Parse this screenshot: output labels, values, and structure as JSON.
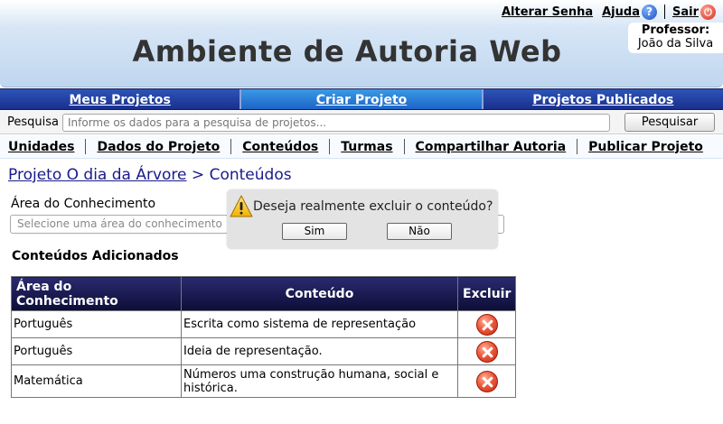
{
  "header": {
    "app_title": "Ambiente de Autoria Web",
    "links": {
      "change_password": "Alterar Senha",
      "help": "Ajuda",
      "logout": "Sair"
    },
    "user": {
      "role": "Professor:",
      "name": "João da Silva"
    }
  },
  "main_nav": {
    "tabs": [
      {
        "label": "Meus Projetos"
      },
      {
        "label": "Criar Projeto",
        "active": true
      },
      {
        "label": "Projetos Publicados"
      }
    ]
  },
  "search": {
    "label": "Pesquisa",
    "placeholder": "Informe os dados para a pesquisa de projetos...",
    "button": "Pesquisar"
  },
  "sub_nav": {
    "items": [
      "Unidades",
      "Dados do Projeto",
      "Conteúdos",
      "Turmas",
      "Compartilhar Autoria",
      "Publicar Projeto"
    ]
  },
  "breadcrumb": {
    "project": "Projeto O dia da Árvore",
    "separator": ">",
    "current": "Conteúdos"
  },
  "form": {
    "area_label": "Área do Conhecimento",
    "area_placeholder": "Selecione uma área do conhecimento"
  },
  "contents": {
    "title": "Conteúdos Adicionados",
    "columns": [
      "Área do Conhecimento",
      "Conteúdo",
      "Excluir"
    ],
    "rows": [
      {
        "area": "Português",
        "content": "Escrita como sistema de representação"
      },
      {
        "area": "Português",
        "content": "Ideia de representação."
      },
      {
        "area": "Matemática",
        "content": "Números uma construção humana, social e histórica."
      }
    ]
  },
  "dialog": {
    "message": "Deseja realmente excluir o conteúdo?",
    "yes": "Sim",
    "no": "Não"
  },
  "icons": {
    "help": "help-icon",
    "logout": "power-icon",
    "warning": "warning-icon",
    "delete": "delete-icon"
  },
  "colors": {
    "nav_dark": "#1a2f8c",
    "nav_active": "#3a9ae6",
    "table_header": "#0d0d38",
    "delete": "#ee5a3a"
  }
}
